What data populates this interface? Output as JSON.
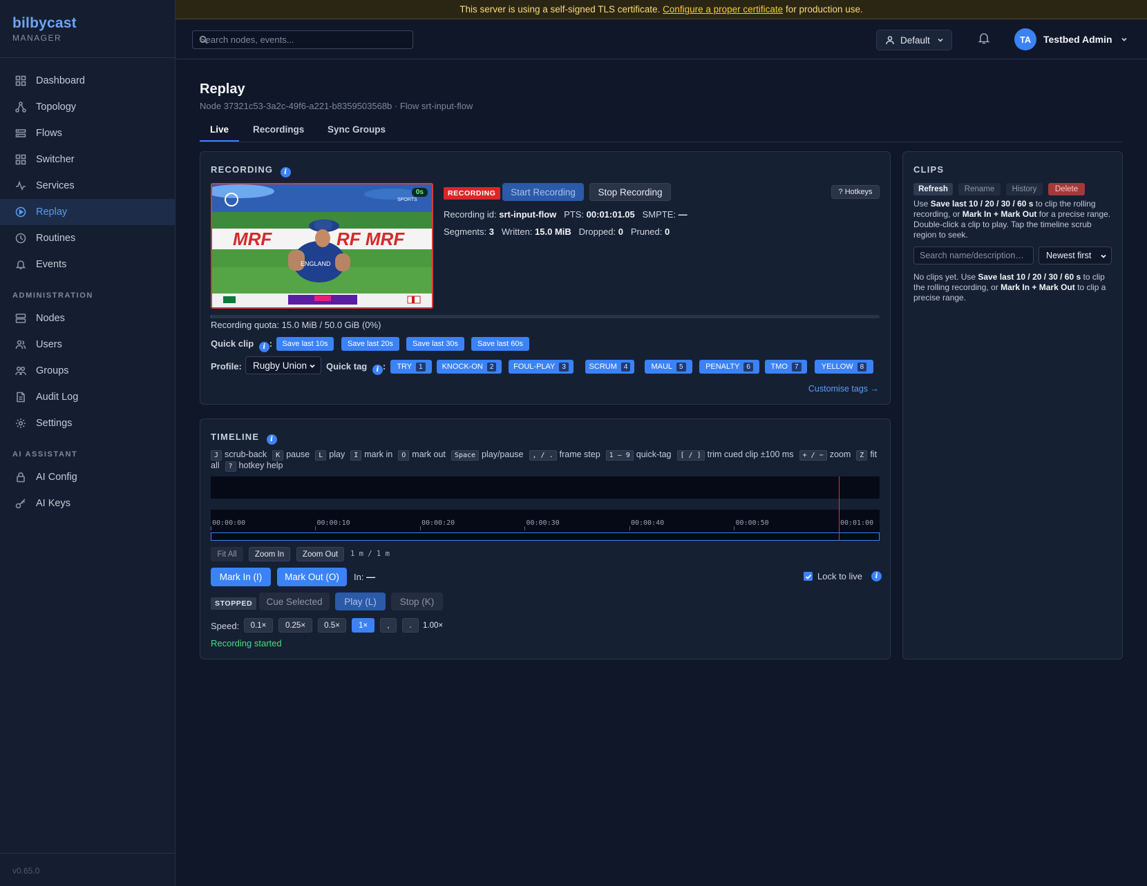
{
  "brand": {
    "name": "bilbycast",
    "sub": "MANAGER"
  },
  "nav": {
    "main": [
      {
        "label": "Dashboard",
        "icon": "grid-icon"
      },
      {
        "label": "Topology",
        "icon": "topology-icon"
      },
      {
        "label": "Flows",
        "icon": "flows-icon"
      },
      {
        "label": "Switcher",
        "icon": "switcher-icon"
      },
      {
        "label": "Services",
        "icon": "activity-icon"
      },
      {
        "label": "Replay",
        "icon": "play-circle-icon"
      },
      {
        "label": "Routines",
        "icon": "clock-icon"
      },
      {
        "label": "Events",
        "icon": "bell-icon"
      }
    ],
    "admin_title": "ADMINISTRATION",
    "admin": [
      {
        "label": "Nodes",
        "icon": "server-icon"
      },
      {
        "label": "Users",
        "icon": "users-icon"
      },
      {
        "label": "Groups",
        "icon": "groups-icon"
      },
      {
        "label": "Audit Log",
        "icon": "file-icon"
      },
      {
        "label": "Settings",
        "icon": "gear-icon"
      }
    ],
    "ai_title": "AI ASSISTANT",
    "ai": [
      {
        "label": "AI Config",
        "icon": "lock-icon"
      },
      {
        "label": "AI Keys",
        "icon": "key-icon"
      }
    ]
  },
  "version": "v0.65.0",
  "banner": {
    "pre": "This server is using a self-signed TLS certificate.",
    "link": "Configure a proper certificate",
    "post": "for production use."
  },
  "topbar": {
    "search_placeholder": "Search nodes, events...",
    "tenant": "Default",
    "avatar": "TA",
    "user": "Testbed Admin"
  },
  "page": {
    "title": "Replay",
    "subtitle": "Node 37321c53-3a2c-49f6-a221-b8359503568b · Flow srt-input-flow",
    "tabs": [
      "Live",
      "Recordings",
      "Sync Groups"
    ]
  },
  "recording": {
    "title": "RECORDING",
    "video_timer": "0s",
    "status_badge": "RECORDING",
    "start_label": "Start Recording",
    "stop_label": "Stop Recording",
    "hotkeys_label": "? Hotkeys",
    "id_label": "Recording id:",
    "id_value": "srt-input-flow",
    "pts_label": "PTS:",
    "pts_value": "00:01:01.05",
    "smpte_label": "SMPTE:",
    "smpte_value": "—",
    "segments_label": "Segments:",
    "segments_value": "3",
    "written_label": "Written:",
    "written_value": "15.0 MiB",
    "dropped_label": "Dropped:",
    "dropped_value": "0",
    "pruned_label": "Pruned:",
    "pruned_value": "0",
    "quota_text": "Recording quota: 15.0 MiB / 50.0 GiB (0%)",
    "quota_fraction": 0.0003,
    "quick_clip_label": "Quick clip",
    "quick_clips": [
      "Save last 10s",
      "Save last 20s",
      "Save last 30s",
      "Save last 60s"
    ],
    "profile_label": "Profile:",
    "profile_value": "Rugby Union",
    "quick_tag_label": "Quick tag",
    "tags": [
      {
        "label": "TRY",
        "key": "1"
      },
      {
        "label": "KNOCK-ON",
        "key": "2"
      },
      {
        "label": "FOUL-PLAY",
        "key": "3"
      },
      {
        "label": "SCRUM",
        "key": "4"
      },
      {
        "label": "MAUL",
        "key": "5"
      },
      {
        "label": "PENALTY",
        "key": "6"
      },
      {
        "label": "TMO",
        "key": "7"
      },
      {
        "label": "YELLOW",
        "key": "8"
      }
    ],
    "customise_label": "Customise tags →"
  },
  "timeline": {
    "title": "TIMELINE",
    "hotkeys": [
      {
        "k": "J",
        "t": "scrub-back"
      },
      {
        "k": "K",
        "t": "pause"
      },
      {
        "k": "L",
        "t": "play"
      },
      {
        "k": "I",
        "t": "mark in"
      },
      {
        "k": "O",
        "t": "mark out"
      },
      {
        "k": "Space",
        "t": "play/pause"
      },
      {
        "k": ", / .",
        "t": "frame step"
      },
      {
        "k": "1 – 9",
        "t": "quick-tag"
      },
      {
        "k": "[ / ]",
        "t": "trim cued clip ±100 ms"
      },
      {
        "k": "+ / −",
        "t": "zoom"
      },
      {
        "k": "Z",
        "t": "fit all"
      },
      {
        "k": "?",
        "t": "hotkey help"
      }
    ],
    "ticks": [
      "00:00:00",
      "00:00:10",
      "00:00:20",
      "00:00:30",
      "00:00:40",
      "00:00:50",
      "00:01:00"
    ],
    "playhead_fraction": 0.939,
    "fit_all": "Fit All",
    "zoom_in": "Zoom In",
    "zoom_out": "Zoom Out",
    "zoom_readout": "1 m / 1 m",
    "mark_in": "Mark In (I)",
    "mark_out": "Mark Out (O)",
    "in_label": "In:",
    "in_value": "—",
    "lock_label": "Lock to live",
    "lock_checked": true,
    "state_badge": "STOPPED",
    "cue_selected": "Cue Selected",
    "play": "Play (L)",
    "stop": "Stop (K)",
    "speed_label": "Speed:",
    "speeds": [
      "0.1×",
      "0.25×",
      "0.5×",
      "1×",
      ",",
      "."
    ],
    "speed_value": "1.00×",
    "status_msg": "Recording started"
  },
  "clips": {
    "title": "CLIPS",
    "actions": [
      "Refresh",
      "Rename",
      "History",
      "Delete"
    ],
    "help_pre": "Use ",
    "help_b1": "Save last 10 / 20 / 30 / 60 s",
    "help_mid1": " to clip the rolling recording, or ",
    "help_b2": "Mark In + Mark Out",
    "help_post": " for a precise range. Double-click a clip to play. Tap the timeline scrub region to seek.",
    "search_placeholder": "Search name/description…",
    "sort_value": "Newest first",
    "empty_pre": "No clips yet. Use ",
    "empty_b1": "Save last 10 / 20 / 30 / 60 s",
    "empty_mid": " to clip the rolling recording, or ",
    "empty_b2": "Mark In + Mark Out",
    "empty_post": " to clip a precise range."
  }
}
